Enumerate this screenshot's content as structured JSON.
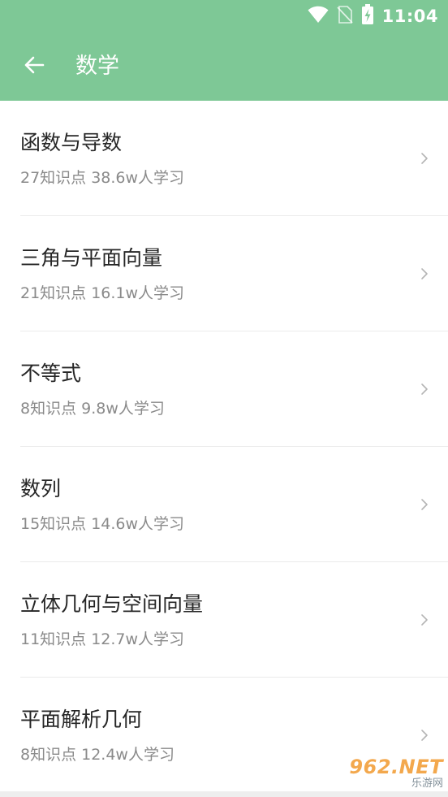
{
  "status_bar": {
    "time": "11:04",
    "icons": [
      "wifi-icon",
      "no-sim-icon",
      "battery-charging-icon"
    ]
  },
  "toolbar": {
    "back_icon": "arrow-left-icon",
    "title": "数学",
    "background": "#7ec896"
  },
  "items": [
    {
      "title": "函数与导数",
      "subtitle": "27知识点 38.6w人学习"
    },
    {
      "title": "三角与平面向量",
      "subtitle": "21知识点 16.1w人学习"
    },
    {
      "title": "不等式",
      "subtitle": "8知识点 9.8w人学习"
    },
    {
      "title": "数列",
      "subtitle": "15知识点 14.6w人学习"
    },
    {
      "title": "立体几何与空间向量",
      "subtitle": "11知识点 12.7w人学习"
    },
    {
      "title": "平面解析几何",
      "subtitle": "8知识点 12.4w人学习"
    }
  ],
  "watermark": {
    "logo": "962.NET",
    "text": "乐游网"
  }
}
